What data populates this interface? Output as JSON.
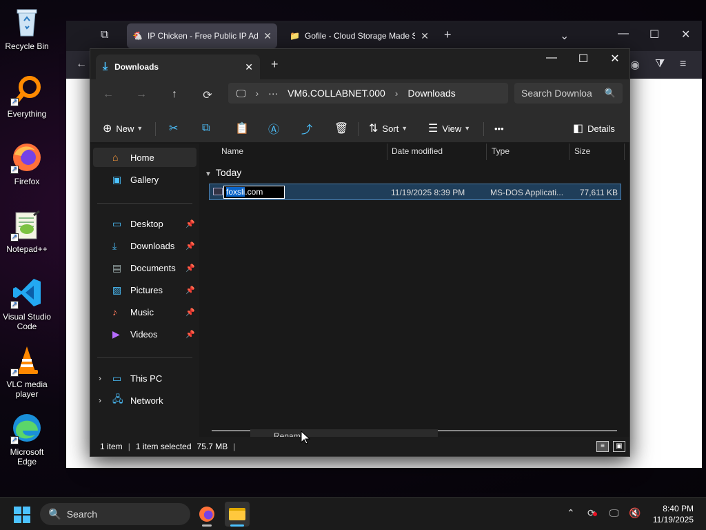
{
  "desktop": {
    "icons": [
      {
        "label": "Recycle Bin"
      },
      {
        "label": "Everything"
      },
      {
        "label": "Firefox"
      },
      {
        "label": "Notepad++"
      },
      {
        "label": "Visual Studio Code"
      },
      {
        "label": "VLC media player"
      },
      {
        "label": "Microsoft Edge"
      }
    ]
  },
  "browser": {
    "tabs": [
      {
        "title": "IP Chicken - Free Public IP Addr",
        "close": "✕"
      },
      {
        "title": "Gofile - Cloud Storage Made Si",
        "close": "✕"
      }
    ],
    "new_tab": "+"
  },
  "explorer": {
    "tab_title": "Downloads",
    "tab_close": "✕",
    "new_tab": "+",
    "window_controls": {
      "minimize": "—",
      "maximize": "☐",
      "close": "✕"
    },
    "nav": {
      "back": "←",
      "forward": "→",
      "up": "↑",
      "refresh": "⟳"
    },
    "address": {
      "pc_icon": "🖵",
      "sep": "›",
      "ellipsis": "···",
      "segment1": "VM6.COLLABNET.000",
      "segment2": "Downloads"
    },
    "search": {
      "placeholder": "Search Downloa"
    },
    "commands": {
      "new": "New",
      "sort": "Sort",
      "view": "View",
      "more": "•••",
      "details": "Details"
    },
    "sidebar": {
      "home": "Home",
      "gallery": "Gallery",
      "quick": [
        {
          "label": "Desktop"
        },
        {
          "label": "Downloads"
        },
        {
          "label": "Documents"
        },
        {
          "label": "Pictures"
        },
        {
          "label": "Music"
        },
        {
          "label": "Videos"
        }
      ],
      "this_pc": "This PC",
      "network": "Network"
    },
    "columns": {
      "name": "Name",
      "date": "Date modified",
      "type": "Type",
      "size": "Size"
    },
    "group": "Today",
    "file": {
      "rename_selected": "foxsli",
      "rename_rest": ".com",
      "date": "11/19/2025 8:39 PM",
      "type": "MS-DOS Applicati...",
      "size": "77,611 KB"
    },
    "tooltip": "Rename",
    "status": {
      "count": "1 item",
      "selected": "1 item selected",
      "size": "75.7 MB"
    }
  },
  "taskbar": {
    "search": "Search",
    "time": "8:40 PM",
    "date": "11/19/2025"
  },
  "colors": {
    "accent": "#4cc2ff",
    "selection": "#1f3e5a",
    "selection_border": "#4a7fb0"
  }
}
